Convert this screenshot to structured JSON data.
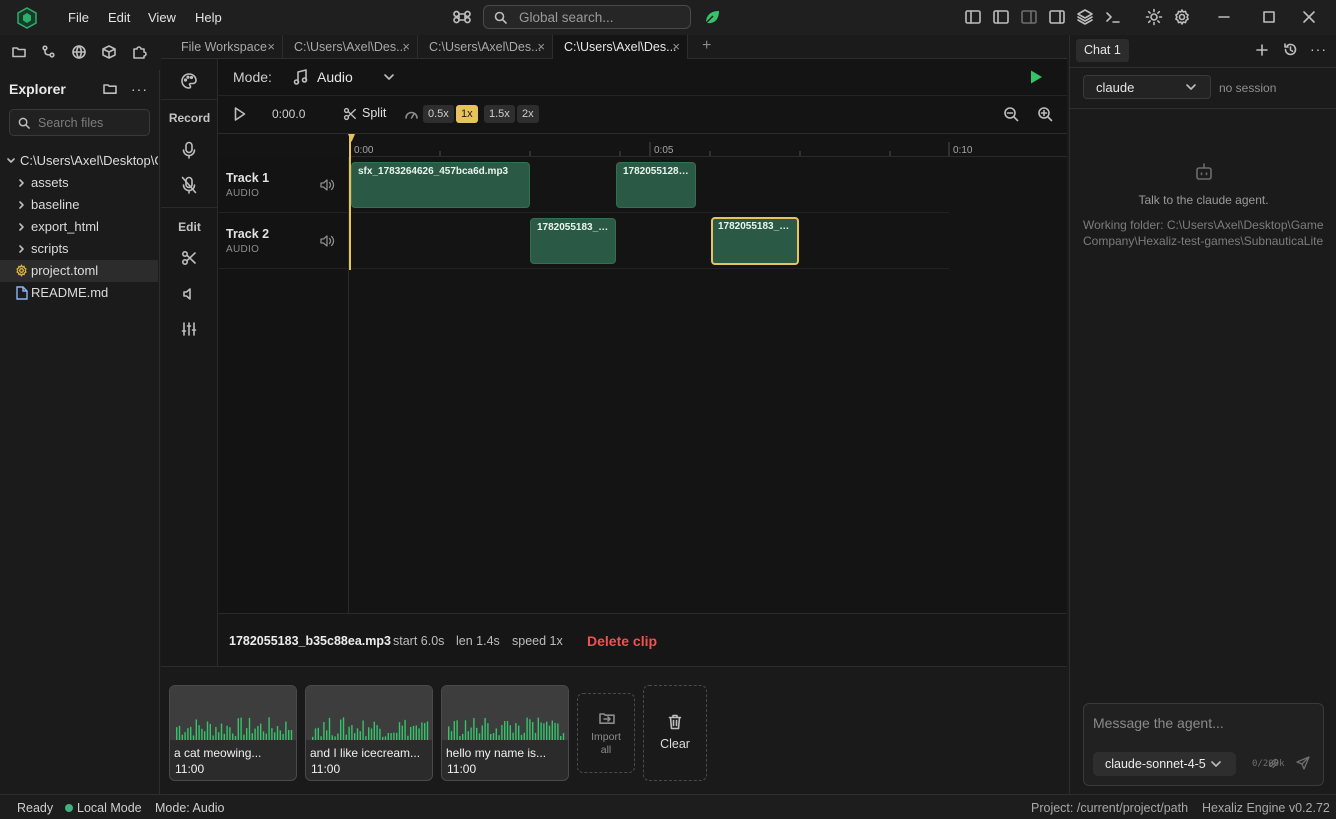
{
  "menu": {
    "file": "File",
    "edit": "Edit",
    "view": "View",
    "help": "Help"
  },
  "search": {
    "placeholder": "Global search..."
  },
  "explorer": {
    "title": "Explorer",
    "search_placeholder": "Search files",
    "root": "C:\\Users\\Axel\\Desktop\\G",
    "items": [
      {
        "label": "assets",
        "kind": "folder"
      },
      {
        "label": "baseline",
        "kind": "folder"
      },
      {
        "label": "export_html",
        "kind": "folder"
      },
      {
        "label": "scripts",
        "kind": "folder"
      },
      {
        "label": "project.toml",
        "kind": "settings-file"
      },
      {
        "label": "README.md",
        "kind": "file"
      }
    ]
  },
  "tabs": [
    {
      "label": "File Workspace",
      "close": "×"
    },
    {
      "label": "C:\\Users\\Axel\\Des...",
      "close": "×"
    },
    {
      "label": "C:\\Users\\Axel\\Des...",
      "close": "×"
    },
    {
      "label": "C:\\Users\\Axel\\Des...",
      "close": "×"
    }
  ],
  "tab_add": "+",
  "tools": {
    "record_label": "Record",
    "edit_label": "Edit"
  },
  "editor": {
    "mode_label": "Mode:",
    "mode_value": "Audio",
    "time": "0:00.0",
    "split_label": "Split",
    "speeds": [
      "0.5x",
      "1x",
      "1.5x",
      "2x"
    ],
    "active_speed": "1x",
    "ruler_ticks": [
      "0:00",
      "0:05",
      "0:10"
    ]
  },
  "tracks": [
    {
      "name": "Track 1",
      "type": "AUDIO",
      "clips": [
        "sfx_1783264626_457bca6d.mp3",
        "1782055128_..."
      ]
    },
    {
      "name": "Track 2",
      "type": "AUDIO",
      "clips": [
        "1782055183_b...",
        "1782055183_b..."
      ]
    }
  ],
  "clip_info": {
    "name": "1782055183_b35c88ea.mp3",
    "start": "start 6.0s",
    "len": "len 1.4s",
    "speed": "speed 1x",
    "delete_label": "Delete clip"
  },
  "assets": [
    {
      "name": "a cat meowing...",
      "time": "11:00"
    },
    {
      "name": "and I like icecream...",
      "time": "11:00"
    },
    {
      "name": "hello my name is...",
      "time": "11:00"
    }
  ],
  "asset_actions": {
    "import_line1": "Import",
    "import_line2": "all",
    "clear_label": "Clear"
  },
  "chat": {
    "tab_label": "Chat 1",
    "agent": "claude",
    "session": "no session",
    "empty_text": "Talk to the claude agent.",
    "working_folder": "Working folder: C:\\Users\\Axel\\Desktop\\Game Company\\Hexaliz-test-games\\SubnauticaLite",
    "input_placeholder": "Message the agent...",
    "model": "claude-sonnet-4-5",
    "token_count": "0/200k"
  },
  "status": {
    "ready": "Ready",
    "local_mode": "Local Mode",
    "mode": "Mode: Audio",
    "project": "Project: /current/project/path",
    "engine": "Hexaliz Engine v0.2.72"
  },
  "colors": {
    "accent": "#e6c35c",
    "clip": "#2a5a46",
    "danger": "#ef5350",
    "status_dot": "#3fb27f",
    "wave": "#35c46a"
  }
}
